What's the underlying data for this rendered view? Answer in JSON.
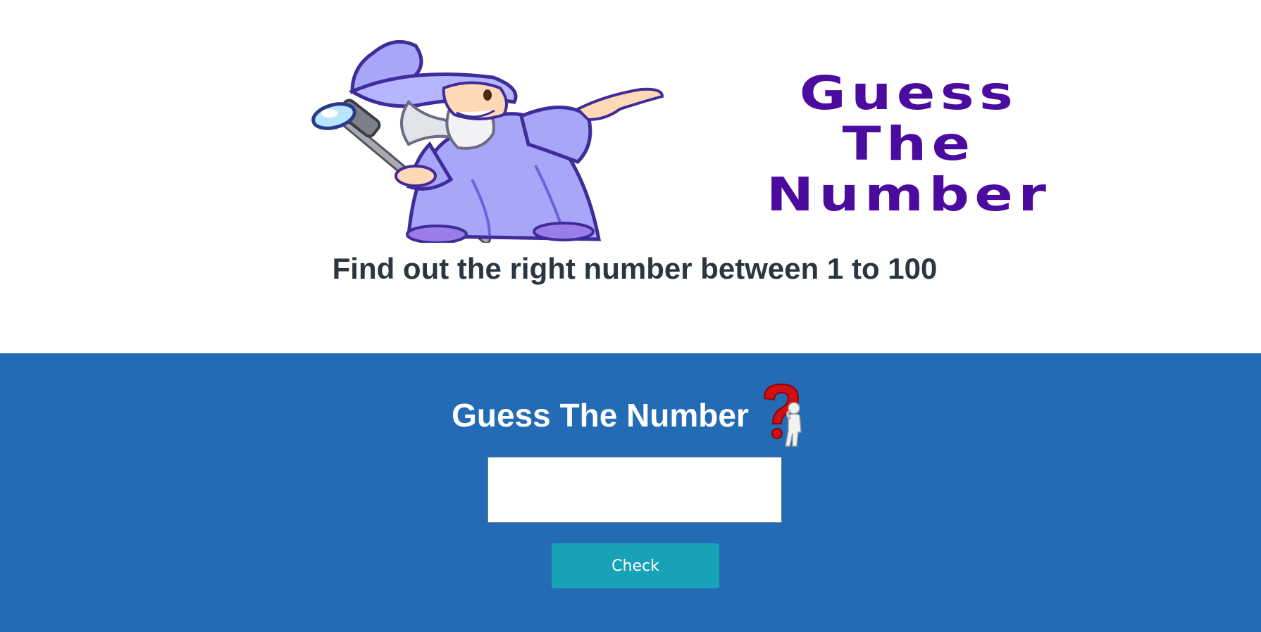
{
  "hero": {
    "logo_lines": [
      "Guess",
      "The",
      "Number"
    ],
    "subtitle": "Find out the right number between 1 to 100",
    "wizard_icon": "wizard-illustration",
    "logo_color": "#4b0b9e"
  },
  "game": {
    "title": "Guess The Number",
    "title_icon": "question-figure-icon",
    "input_value": "",
    "check_label": "Check",
    "panel_color": "#236cb5",
    "button_color": "#17a2b8"
  }
}
